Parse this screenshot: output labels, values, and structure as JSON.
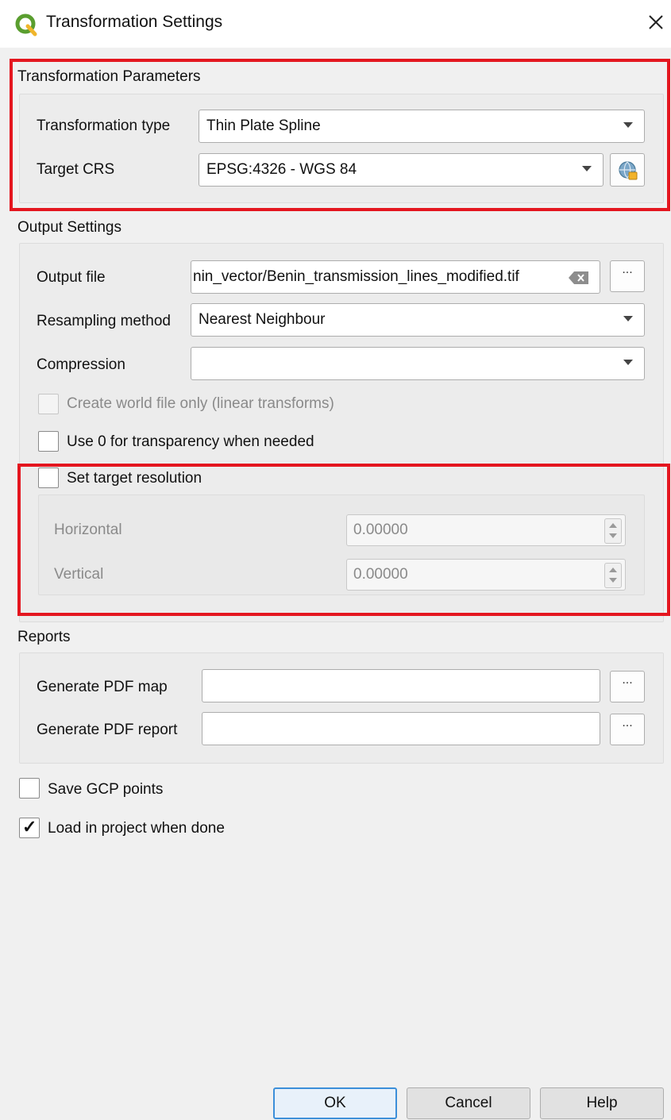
{
  "window": {
    "title": "Transformation Settings",
    "icon": "qgis-logo-icon",
    "close_icon": "close-icon"
  },
  "transformation_parameters": {
    "heading": "Transformation Parameters",
    "type_label": "Transformation type",
    "type_value": "Thin Plate Spline",
    "crs_label": "Target CRS",
    "crs_value": "EPSG:4326 - WGS 84",
    "crs_selector_icon": "globe-crs-icon"
  },
  "output_settings": {
    "heading": "Output Settings",
    "output_file_label": "Output file",
    "output_file_value": "nin_vector/Benin_transmission_lines_modified.tif",
    "clear_icon": "clear-text-icon",
    "browse_label": "...",
    "resampling_label": "Resampling method",
    "resampling_value": "Nearest Neighbour",
    "compression_label": "Compression",
    "compression_value": "",
    "world_file_label": "Create world file only (linear transforms)",
    "world_file_checked": false,
    "transparency_label": "Use 0 for transparency when needed",
    "transparency_checked": false
  },
  "target_resolution": {
    "label": "Set target resolution",
    "checked": false,
    "horizontal_label": "Horizontal",
    "horizontal_value": "0.00000",
    "vertical_label": "Vertical",
    "vertical_value": "0.00000"
  },
  "reports": {
    "heading": "Reports",
    "pdf_map_label": "Generate PDF map",
    "pdf_map_value": "",
    "pdf_report_label": "Generate PDF report",
    "pdf_report_value": "",
    "browse_label": "..."
  },
  "options": {
    "save_gcp_label": "Save GCP points",
    "save_gcp_checked": false,
    "load_project_label": "Load in project when done",
    "load_project_checked": true,
    "check_mark": "✓"
  },
  "buttons": {
    "ok": "OK",
    "cancel": "Cancel",
    "help": "Help"
  },
  "colors": {
    "highlight": "#e4161f",
    "dialog_bg": "#f0f0f0",
    "default_button_border": "#3c8fd9"
  }
}
